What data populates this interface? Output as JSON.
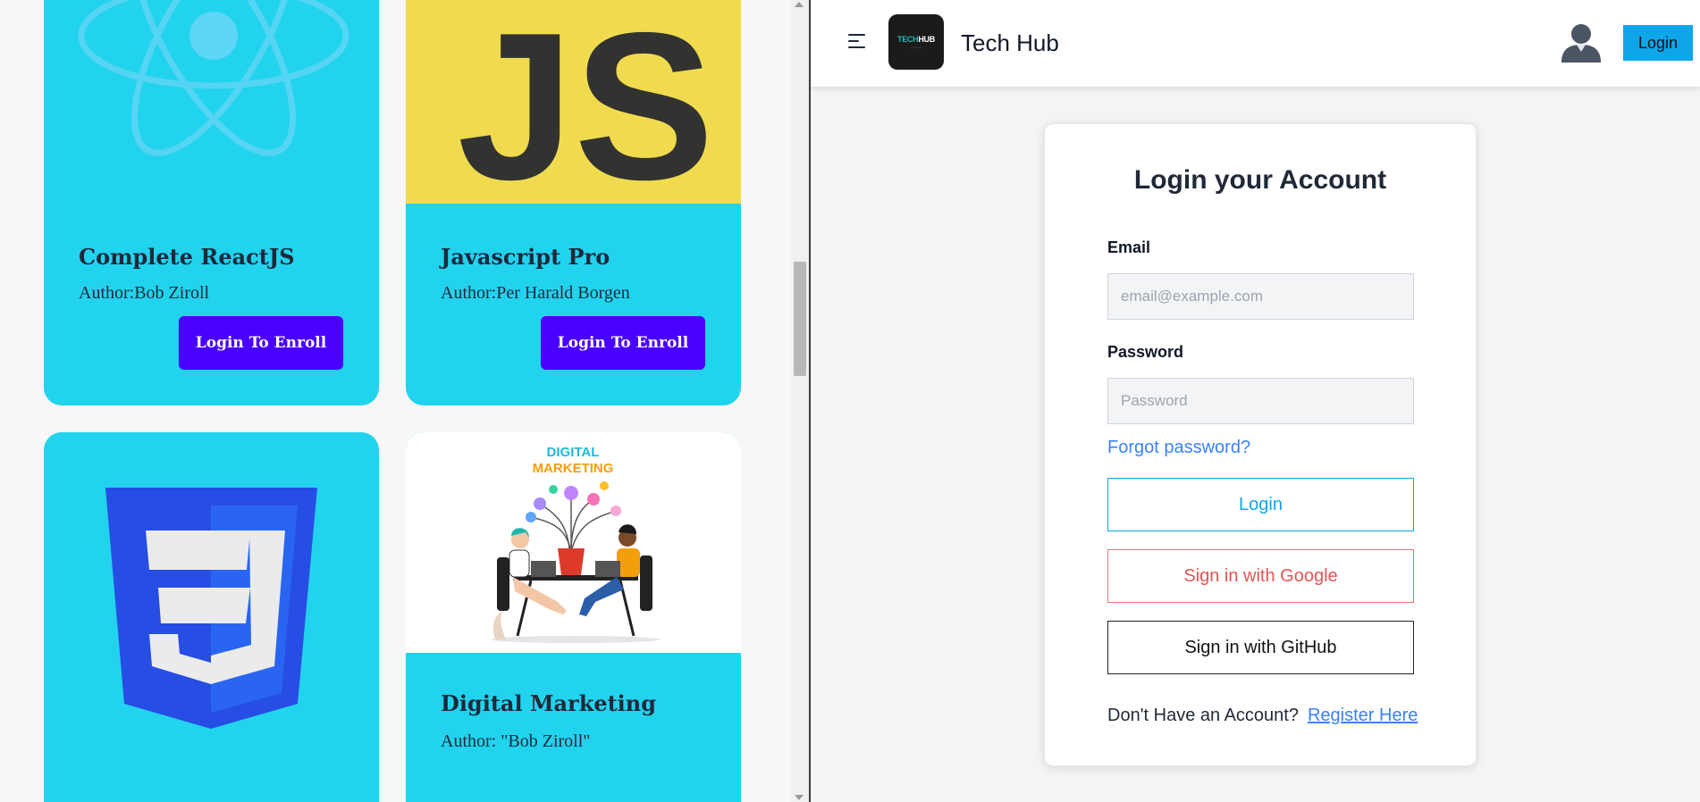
{
  "courses": [
    {
      "title": "Complete ReactJS",
      "author": "Author:Bob Ziroll",
      "button": "Login To Enroll",
      "image": "react-logo-icon"
    },
    {
      "title": "Javascript Pro",
      "author": "Author:Per Harald Borgen",
      "button": "Login To Enroll",
      "image": "js-logo-icon",
      "image_text": "JS"
    },
    {
      "title": "",
      "author": "",
      "button": "",
      "image": "css3-logo-icon",
      "image_text": "3"
    },
    {
      "title": "Digital Marketing",
      "author": "Author: \"Bob Ziroll\"",
      "button": "",
      "image": "digital-marketing-illustration",
      "image_text_line1": "DIGITAL",
      "image_text_line2": "MARKETING"
    }
  ],
  "navbar": {
    "menu_icon": "hamburger-menu-icon",
    "logo_text_a": "TECH",
    "logo_text_b": "HUB",
    "brand": "Tech Hub",
    "avatar_icon": "user-avatar-icon",
    "login_label": "Login"
  },
  "login_form": {
    "heading": "Login your Account",
    "email_label": "Email",
    "email_placeholder": "email@example.com",
    "password_label": "Password",
    "password_placeholder": "Password",
    "forgot": "Forgot password?",
    "login_button": "Login",
    "google_button": "Sign in with Google",
    "github_button": "Sign in with GitHub",
    "register_prompt": "Don't Have an Account?",
    "register_link": "Register Here"
  },
  "colors": {
    "card_bg": "#22d3ee",
    "enroll_button": "#4a00ff",
    "js_yellow": "#f0db4f",
    "css_blue": "#264de4",
    "primary": "#0ea5e9",
    "link": "#3b82f6",
    "google_red": "#e25555"
  }
}
